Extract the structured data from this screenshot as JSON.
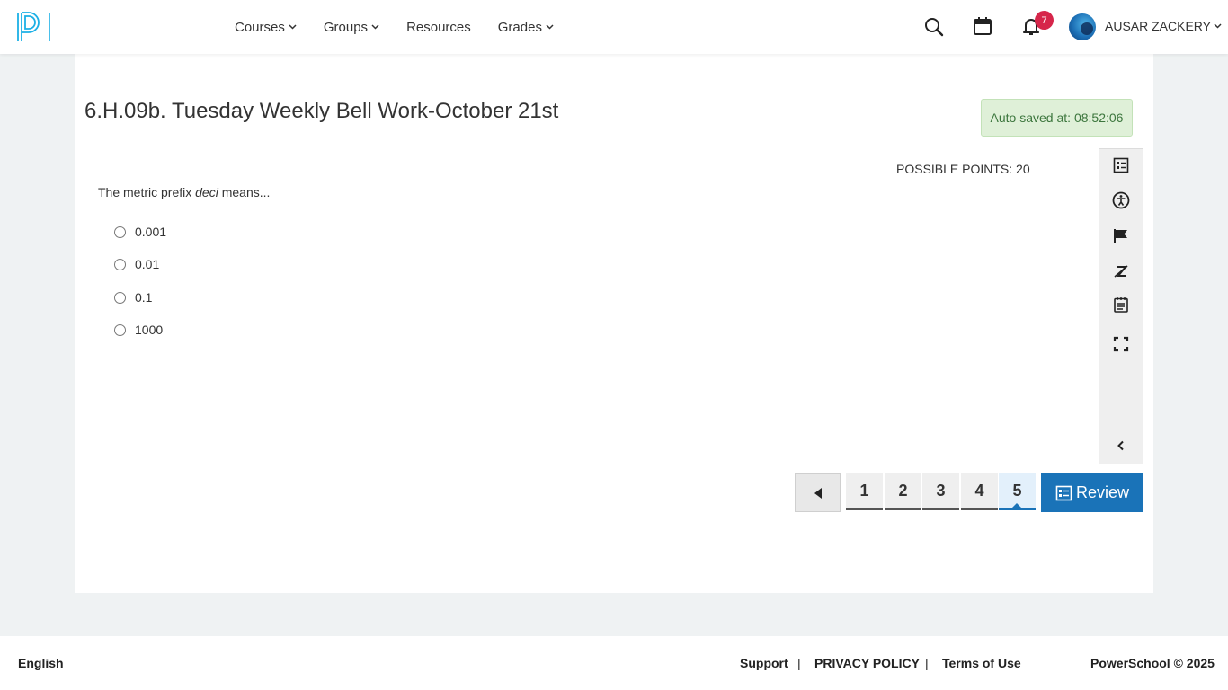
{
  "header": {
    "nav": [
      {
        "label": "Courses",
        "has_dropdown": true
      },
      {
        "label": "Groups",
        "has_dropdown": true
      },
      {
        "label": "Resources",
        "has_dropdown": false
      },
      {
        "label": "Grades",
        "has_dropdown": true
      }
    ],
    "notification_count": "7",
    "user_name": "AUSAR ZACKERY",
    "icons": [
      "search-icon",
      "calendar-icon",
      "bell-icon"
    ]
  },
  "assessment": {
    "title": "6.H.09b. Tuesday Weekly Bell Work-October 21st",
    "autosave": "Auto saved at: 08:52:06",
    "possible_points": "POSSIBLE POINTS: 20",
    "question_prefix": "The metric prefix ",
    "question_term": "deci",
    "question_suffix": " means...",
    "options": [
      "0.001",
      "0.01",
      "0.1",
      "1000"
    ]
  },
  "toolbar": [
    "question-list-icon",
    "accessibility-icon",
    "flag-icon",
    "strikethrough-icon",
    "notepad-icon",
    "fullscreen-icon",
    "collapse-icon"
  ],
  "pager": {
    "pages": [
      "1",
      "2",
      "3",
      "4",
      "5"
    ],
    "active_page": "5",
    "review_label": "Review"
  },
  "footer": {
    "language": "English",
    "support": "Support",
    "separator": "|",
    "privacy": "PRIVACY POLICY",
    "terms": "Terms of Use",
    "copyright": "PowerSchool © 2025"
  },
  "colors": {
    "primary": "#1a73b8",
    "badge": "#d6264a",
    "autosave_bg": "#dff0d8",
    "autosave_text": "#3c763d",
    "logo": "#1cb0e6"
  }
}
